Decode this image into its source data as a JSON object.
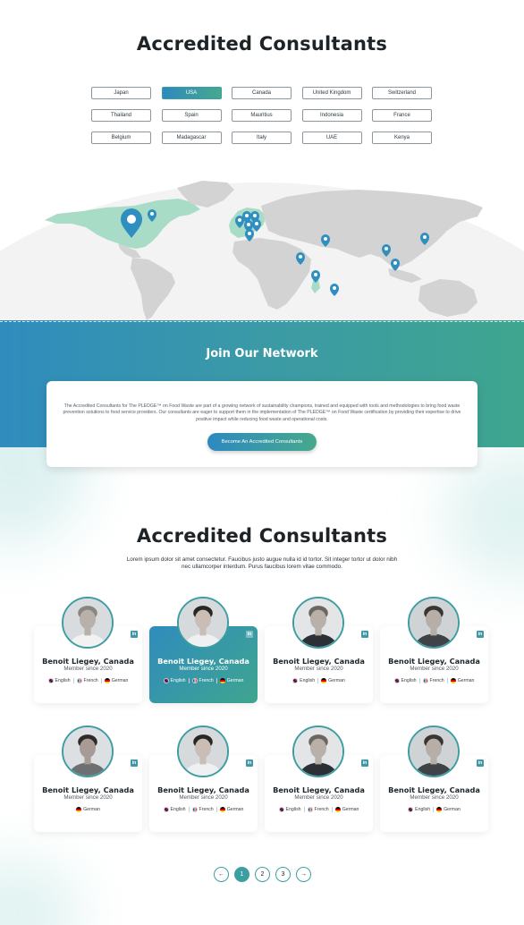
{
  "section1": {
    "title": "Accredited Consultants",
    "countries": [
      "Japan",
      "USA",
      "Canada",
      "United Kingdom",
      "Switzerland",
      "Thailand",
      "Spain",
      "Mauritius",
      "Indonesia",
      "France",
      "Belgium",
      "Madagascar",
      "Italy",
      "UAE",
      "Kenya"
    ],
    "selected_country": "USA"
  },
  "join": {
    "title": "Join Our Network",
    "description": "The Accredited Consultants for The PLEDGE™ on Food Waste are part of a growing network of sustainability champions, trained and equipped with tools and methodologies to bring food waste prevention solutions to food service providers. Our consultants are eager to support them in the implementation of The PLEDGE™ on Food Waste certification by providing their expertise to drive positive impact while reducing food waste and operational costs.",
    "button_label": "Become An Accredited Consultants"
  },
  "section2": {
    "title": "Accredited Consultants",
    "subtitle": "Lorem ipsum dolor sit amet consectetur. Faucibus justo augue nulla id id tortor. Sit integer tortor ut dolor nibh nec ullamcorper interdum. Purus faucibus lorem vitae commodo."
  },
  "consultants": [
    {
      "name": "Benoit Liegey, Canada",
      "since": "Member since 2020",
      "langs": [
        "English",
        "French",
        "German"
      ],
      "active": false
    },
    {
      "name": "Benoit Liegey, Canada",
      "since": "Member since 2020",
      "langs": [
        "English",
        "French",
        "German"
      ],
      "active": true
    },
    {
      "name": "Benoit Liegey, Canada",
      "since": "Member since 2020",
      "langs": [
        "English",
        "German"
      ],
      "active": false
    },
    {
      "name": "Benoit Liegey, Canada",
      "since": "Member since 2020",
      "langs": [
        "English",
        "French",
        "German"
      ],
      "active": false
    },
    {
      "name": "Benoit Liegey, Canada",
      "since": "Member since 2020",
      "langs": [
        "German"
      ],
      "active": false
    },
    {
      "name": "Benoit Liegey, Canada",
      "since": "Member since 2020",
      "langs": [
        "English",
        "French",
        "German"
      ],
      "active": false
    },
    {
      "name": "Benoit Liegey, Canada",
      "since": "Member since 2020",
      "langs": [
        "English",
        "French",
        "German"
      ],
      "active": false
    },
    {
      "name": "Benoit Liegey, Canada",
      "since": "Member since 2020",
      "langs": [
        "English",
        "German"
      ],
      "active": false
    }
  ],
  "social_icon_label": "in",
  "pagination": {
    "prev": "←",
    "pages": [
      "1",
      "2",
      "3"
    ],
    "current": "1",
    "next": "→"
  },
  "colors": {
    "accent": "#3d9ea2",
    "gradient_start": "#2d89bf",
    "gradient_end": "#46a98d",
    "pin": "#2f8fc0",
    "highlight_land": "#a8dcc6"
  }
}
